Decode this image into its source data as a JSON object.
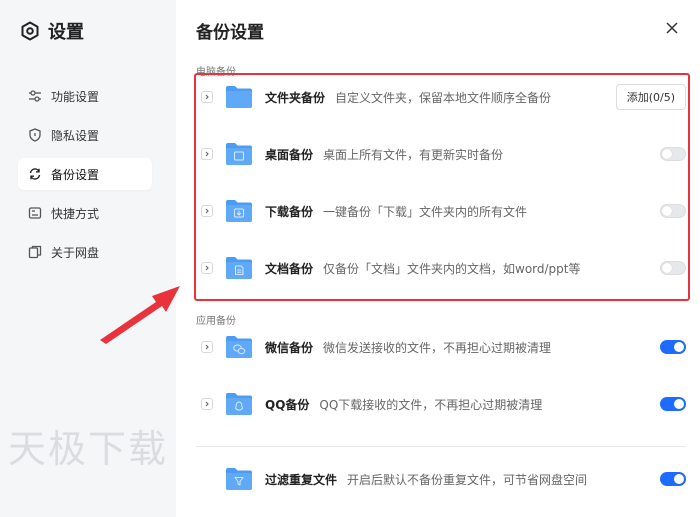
{
  "sidebar": {
    "app_title": "设置",
    "items": [
      {
        "label": "功能设置",
        "icon": "sliders-icon",
        "active": false
      },
      {
        "label": "隐私设置",
        "icon": "shield-icon",
        "active": false
      },
      {
        "label": "备份设置",
        "icon": "sync-icon",
        "active": true
      },
      {
        "label": "快捷方式",
        "icon": "shortcut-icon",
        "active": false
      },
      {
        "label": "关于网盘",
        "icon": "about-icon",
        "active": false
      }
    ],
    "watermark": "天极下载"
  },
  "main": {
    "title": "备份设置",
    "close_icon": "close-icon",
    "sections": {
      "computer": {
        "label": "电脑备份",
        "rows": [
          {
            "name": "文件夹备份",
            "desc": "自定义文件夹，保留本地文件顺序全备份",
            "control": "button",
            "button_label": "添加(0/5)",
            "folder_glyph": "none"
          },
          {
            "name": "桌面备份",
            "desc": "桌面上所有文件，有更新实时备份",
            "control": "toggle",
            "enabled": false,
            "folder_glyph": "desktop-icon"
          },
          {
            "name": "下载备份",
            "desc": "一键备份「下载」文件夹内的所有文件",
            "control": "toggle",
            "enabled": false,
            "folder_glyph": "download-icon"
          },
          {
            "name": "文档备份",
            "desc": "仅备份「文档」文件夹内的文档，如word/ppt等",
            "control": "toggle",
            "enabled": false,
            "folder_glyph": "document-icon"
          }
        ]
      },
      "apps": {
        "label": "应用备份",
        "rows": [
          {
            "name": "微信备份",
            "desc": "微信发送接收的文件，不再担心过期被清理",
            "control": "toggle",
            "enabled": true,
            "folder_glyph": "wechat-icon"
          },
          {
            "name": "QQ备份",
            "desc": "QQ下载接收的文件，不再担心过期被清理",
            "control": "toggle",
            "enabled": true,
            "folder_glyph": "qq-icon"
          }
        ]
      },
      "filter": {
        "name": "过滤重复文件",
        "desc": "开启后默认不备份重复文件，可节省网盘空间",
        "enabled": true,
        "folder_glyph": "filter-icon"
      }
    }
  },
  "colors": {
    "accent": "#1e6bff",
    "folder": "#4c9cf3",
    "highlight": "#e8323c",
    "sidebar_bg": "#f5f6f8"
  }
}
